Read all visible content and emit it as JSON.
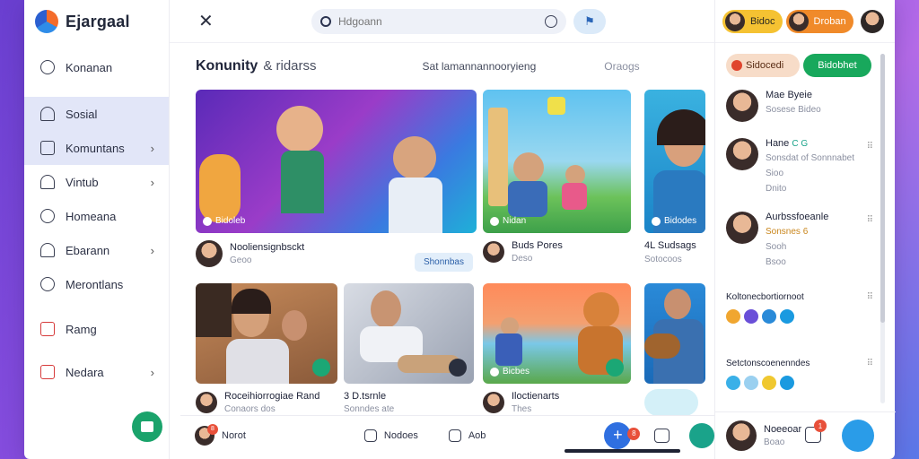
{
  "brand": {
    "name": "Ejargaal"
  },
  "sidebar": {
    "items": [
      {
        "label": "Konanan",
        "icon": "clock-icon",
        "chevron": false,
        "active": false
      },
      {
        "label": "Sosial",
        "icon": "home-icon",
        "chevron": false,
        "active": true
      },
      {
        "label": "Komuntans",
        "icon": "square-icon",
        "chevron": true,
        "active": true
      },
      {
        "label": "Vintub",
        "icon": "home-icon",
        "chevron": true,
        "active": false
      },
      {
        "label": "Homeana",
        "icon": "clock-icon",
        "chevron": false,
        "active": false
      },
      {
        "label": "Ebarann",
        "icon": "home-icon",
        "chevron": true,
        "active": false
      },
      {
        "label": "Merontlans",
        "icon": "clock-icon",
        "chevron": false,
        "active": false
      },
      {
        "label": "Ramg",
        "icon": "square-red-icon",
        "chevron": false,
        "active": false
      },
      {
        "label": "Nedara",
        "icon": "square-red-icon",
        "chevron": true,
        "active": false
      }
    ]
  },
  "topbar": {
    "search_placeholder": "Hdgoann"
  },
  "section": {
    "title": "Konunity",
    "subtitle": "& ridarss",
    "filter": "Sat lamannannooryieng",
    "filter2": "Oraogs"
  },
  "cards": [
    {
      "badge": "Bidoleb",
      "title": "Nooliensignbsckt",
      "sub": "Geoo",
      "pill": "Shonnbas",
      "thumb": "music-play-thumb"
    },
    {
      "badge": "Nidan",
      "title": "Buds Pores",
      "sub": "Deso",
      "thumb": "park-guitar-thumb"
    },
    {
      "badge": "Bidodes",
      "title": "4L Sudsags",
      "sub": "Sotocoos",
      "thumb": "portrait-thumb"
    },
    {
      "badge": "",
      "title": "Roceihiorrogiae Rand",
      "sub": "Conaors dos",
      "thumb": "game-thumb"
    },
    {
      "badge": "",
      "title": "3 D.tsrnle",
      "sub": "Sonndes ate",
      "thumb": "couch-thumb"
    },
    {
      "badge": "Bicbes",
      "title": "Iloctienarts",
      "sub": "Thes",
      "thumb": "cartoon-thumb"
    },
    {
      "badge": "",
      "title": "",
      "sub": "",
      "thumb": "guitar-man-thumb"
    }
  ],
  "bottombar": {
    "items": [
      {
        "label": "Norot",
        "badge": "8"
      },
      {
        "label": "Nodoes",
        "badge": ""
      },
      {
        "label": "Aob",
        "badge": ""
      }
    ],
    "fab_badge": "8"
  },
  "right": {
    "chips": [
      {
        "label": "Bidoc"
      },
      {
        "label": "Droban"
      }
    ],
    "tabs": [
      "Sidocedi",
      "Bidobhet"
    ],
    "people": [
      {
        "name": "Mae Byeie",
        "sub": "Sosese Bideo"
      },
      {
        "name": "Hane",
        "emoji": "C G",
        "sub": "Sonsdat of Sonnnabet",
        "sub2": "Sioo",
        "sub3": "Dnito"
      },
      {
        "name": "Aurbssfoeanle",
        "sub": "Sonsnes 6",
        "sub2": "Sooh",
        "sub3": "Bsoo"
      }
    ],
    "section1": "Koltonecbortiornoot",
    "section2": "Setctonscoenenndes",
    "bottom": {
      "name": "Noeeoar",
      "sub": "Boao",
      "badge": "1"
    }
  }
}
